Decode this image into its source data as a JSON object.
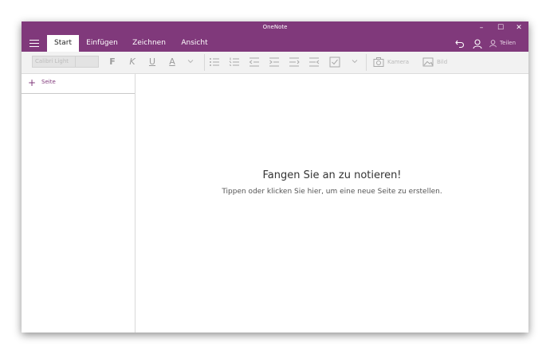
{
  "window": {
    "title": "OneNote",
    "controls": {
      "minimize": "–",
      "maximize": "☐",
      "close": "✕"
    }
  },
  "ribbon": {
    "tabs": [
      {
        "label": "Start",
        "active": true
      },
      {
        "label": "Einfügen",
        "active": false
      },
      {
        "label": "Zeichnen",
        "active": false
      },
      {
        "label": "Ansicht",
        "active": false
      }
    ],
    "share_label": "Teilen"
  },
  "toolbar": {
    "font_name": "Calibri Light",
    "font_size": "",
    "bold": "F",
    "italic": "K",
    "underline": "U",
    "font_color": "A",
    "camera_label": "Kamera",
    "picture_label": "Bild"
  },
  "sidebar": {
    "add_page_label": "Seite",
    "add_symbol": "+"
  },
  "canvas": {
    "empty_title": "Fangen Sie an zu notieren!",
    "empty_hint": "Tippen oder klicken Sie hier, um eine neue Seite zu erstellen."
  },
  "colors": {
    "accent": "#80397b",
    "toolbar_bg": "#f2f2f2",
    "disabled_icon": "#a8a8a8"
  },
  "icons": [
    "hamburger-menu-icon",
    "undo-icon",
    "account-icon",
    "share-person-icon",
    "bullet-list-icon",
    "numbered-list-icon",
    "decrease-indent-icon",
    "increase-indent-icon",
    "checkbox-icon",
    "camera-icon",
    "picture-icon"
  ]
}
